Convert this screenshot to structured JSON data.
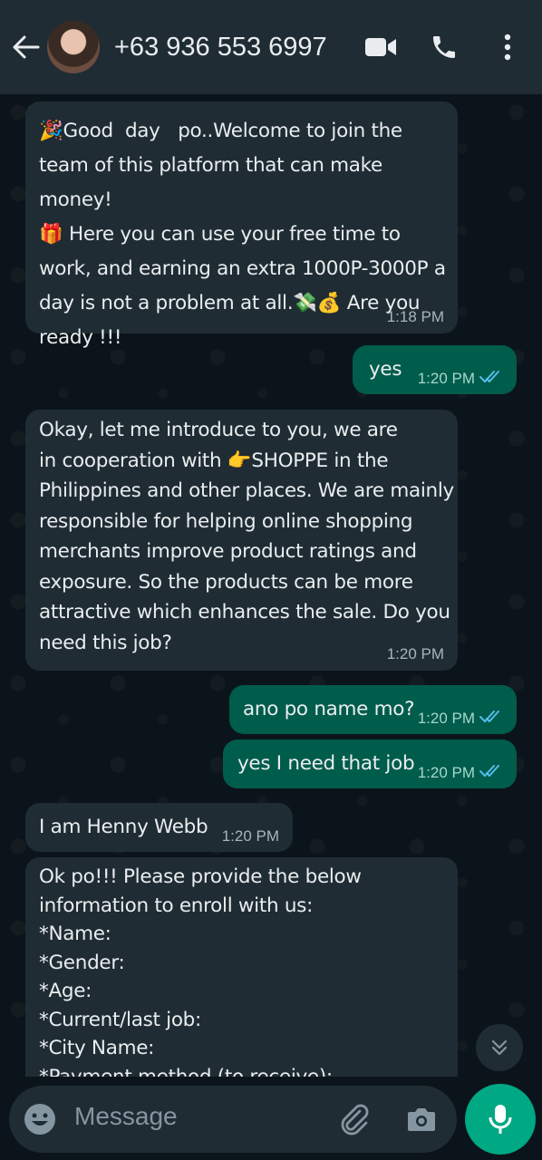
{
  "header": {
    "contact": "+63 936 553 6997"
  },
  "messages": [
    {
      "dir": "in",
      "text": "🎉Good  day   po..Welcome to join the\nteam of this platform that can make money!\n🎁 Here you can use your free time to\nwork, and earning an extra 1000P-3000P a\nday is not a problem at all.💸💰 Are you\nready !!!",
      "time": "1:18 PM"
    },
    {
      "dir": "out",
      "text": "yes",
      "time": "1:20 PM"
    },
    {
      "dir": "in",
      "text": "Okay, let me introduce to you, we are\nin cooperation with 👉SHOPPE in the\nPhilippines and other places. We are mainly\nresponsible for helping online shopping\nmerchants improve product ratings and\nexposure. So the products can be more\nattractive which enhances the sale. Do you\nneed this job?",
      "time": "1:20 PM"
    },
    {
      "dir": "out",
      "text": "ano po name mo?",
      "time": "1:20 PM"
    },
    {
      "dir": "out",
      "text": "yes I need that job",
      "time": "1:20 PM"
    },
    {
      "dir": "in",
      "text": "I am Henny Webb",
      "time": "1:20 PM"
    },
    {
      "dir": "in",
      "text": "Ok po!!! Please provide the below\ninformation to enroll with us:\n*Name:\n*Gender:\n*Age:\n*Current/last job:\n*City Name:\n*Payment method (to receive):",
      "time": ""
    }
  ],
  "input": {
    "placeholder": "Message"
  },
  "colors": {
    "header": "#1f2c34",
    "incoming": "#1f2c34",
    "outgoing": "#005c4b",
    "accent": "#00a884",
    "read_ticks": "#53bdeb"
  }
}
